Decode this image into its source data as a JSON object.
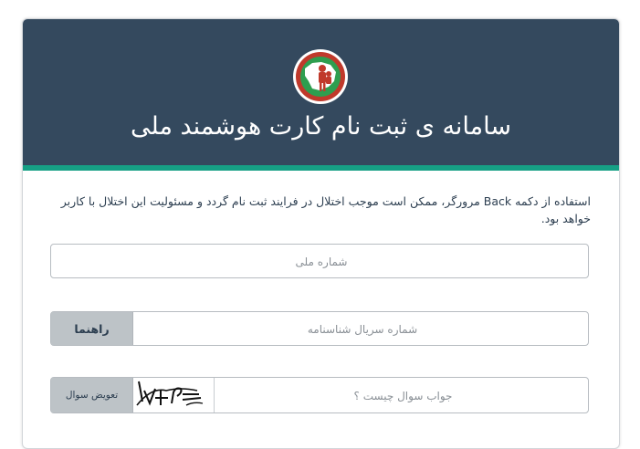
{
  "header": {
    "title": "سامانه ی ثبت نام کارت هوشمند ملی",
    "logo_icon": "national-smart-card-logo",
    "bg_color": "#34495e",
    "accent_color": "#16a085"
  },
  "notice": {
    "text": "استفاده از دکمه Back مرورگر، ممکن است موجب اختلال در فرایند ثبت نام گردد و مسئولیت این اختلال با کاربر خواهد بود."
  },
  "form": {
    "national_id": {
      "placeholder": "شماره ملی",
      "value": ""
    },
    "serial": {
      "placeholder": "شماره سریال شناسنامه",
      "value": "",
      "help_label": "راهنما"
    },
    "captcha": {
      "placeholder": "جواب سوال چیست ؟",
      "value": "",
      "refresh_label": "تعویض سوال",
      "image_icon": "captcha-image"
    }
  }
}
